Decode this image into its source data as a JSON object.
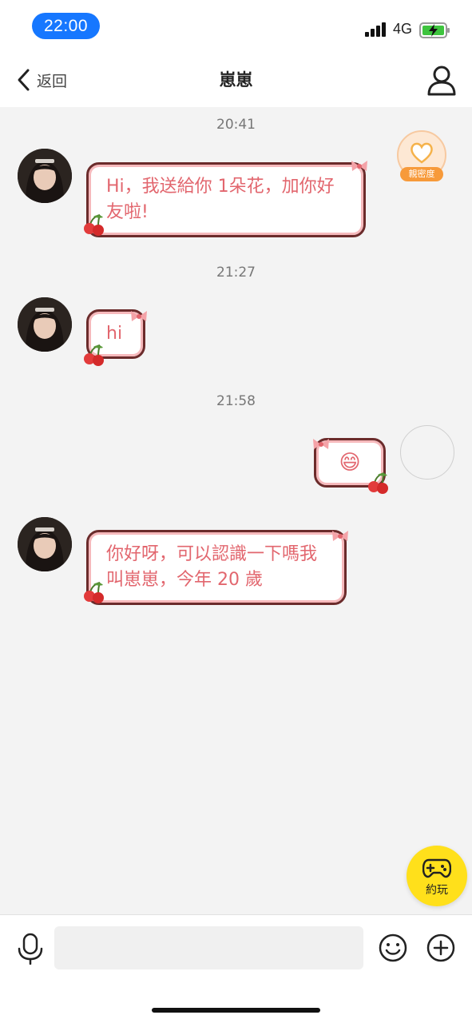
{
  "status_bar": {
    "time": "22:00",
    "network": "4G"
  },
  "nav": {
    "back_label": "返回",
    "title": "崽崽"
  },
  "intimacy": {
    "label": "親密度"
  },
  "messages": [
    {
      "timestamp": "20:41",
      "from": "other",
      "text": "Hi，我送給你 1朵花，加你好友啦!"
    },
    {
      "timestamp": "21:27",
      "from": "other",
      "text": "hi"
    },
    {
      "timestamp": "21:58",
      "from": "self",
      "text": "😄"
    },
    {
      "timestamp": "",
      "from": "other",
      "text": "你好呀，可以認識一下嗎我叫崽崽，今年 20 歲"
    }
  ],
  "fab": {
    "label": "約玩"
  },
  "input": {
    "placeholder": ""
  },
  "colors": {
    "accent_blue": "#1677ff",
    "bubble_text": "#e2666e",
    "bubble_border": "#6b2b2b",
    "fab_yellow": "#ffe01b",
    "intimacy_orange": "#f79a3a"
  }
}
